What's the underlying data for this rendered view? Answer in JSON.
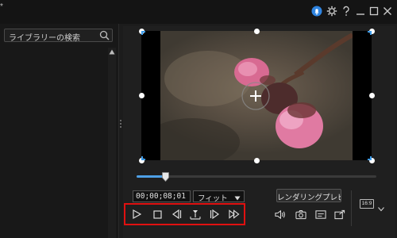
{
  "window": {
    "title_fragment": "*"
  },
  "library": {
    "search_placeholder": "ライブラリーの検索"
  },
  "preview": {
    "timecode": "00;00;08;01",
    "fit_option": "フィット",
    "render_button_label": "レンダリングプレビ...",
    "aspect_ratio": "16:9",
    "playback_progress": 0.12
  },
  "colors": {
    "highlight": "#e01010",
    "accent": "#4ea0e6"
  },
  "icons": {
    "titlebar": [
      "notification-icon",
      "gear-icon",
      "help-icon",
      "minimize-icon",
      "maximize-icon",
      "close-icon"
    ],
    "playback": [
      "play-icon",
      "stop-icon",
      "previous-frame-icon",
      "split-icon",
      "next-frame-icon",
      "fast-forward-icon"
    ],
    "tools": [
      "volume-icon",
      "camera-icon",
      "subtitle-icon",
      "external-preview-icon"
    ]
  }
}
